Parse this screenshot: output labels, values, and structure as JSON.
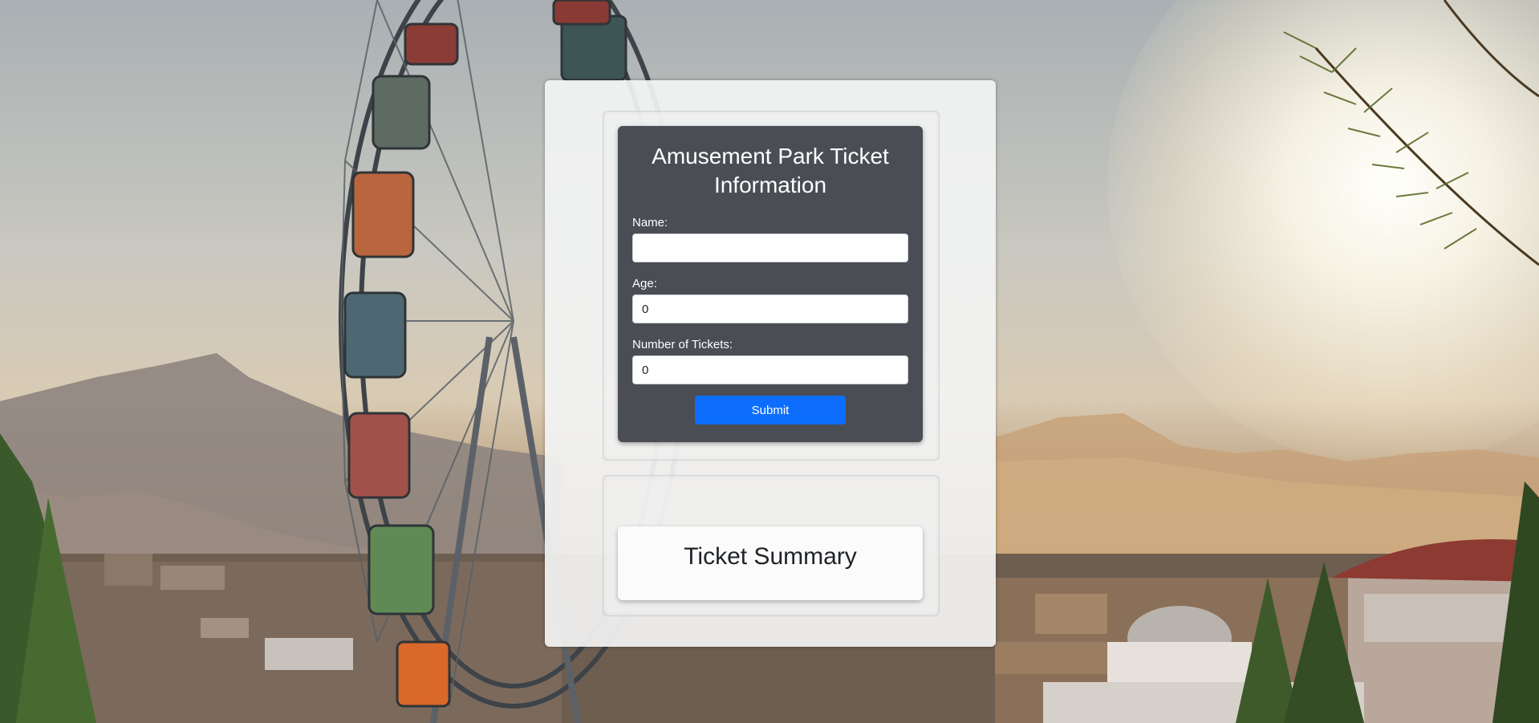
{
  "form": {
    "title": "Amusement Park Ticket Information",
    "name_label": "Name:",
    "name_value": "",
    "age_label": "Age:",
    "age_value": "0",
    "tickets_label": "Number of Tickets:",
    "tickets_value": "0",
    "submit_label": "Submit"
  },
  "summary": {
    "title": "Ticket Summary"
  },
  "colors": {
    "form_background": "#4a4e54",
    "submit_button": "#0d6efd",
    "card_background": "#f2f3f3"
  },
  "background": {
    "description_icon": "ferris-wheel-landscape-photo"
  }
}
